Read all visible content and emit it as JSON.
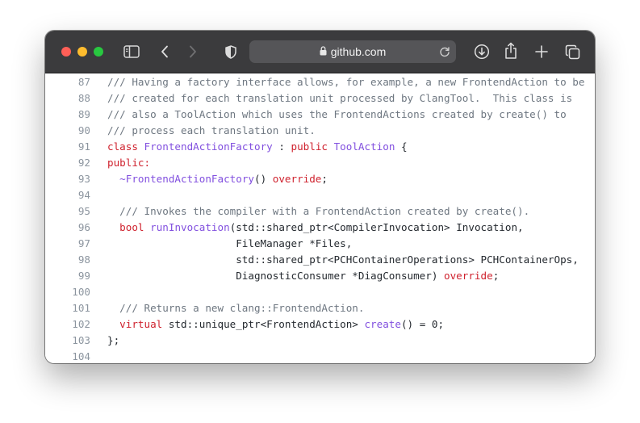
{
  "browser": {
    "url": "github.com",
    "colors": {
      "toolbar": "#3b3b3d",
      "urlbar": "#555558",
      "close": "#ff5f57",
      "minimize": "#febc2e",
      "zoom": "#28c840"
    },
    "icons": [
      "sidebar-icon",
      "back-icon",
      "forward-icon",
      "privacy-shield-icon",
      "lock-icon",
      "reload-icon",
      "download-icon",
      "share-icon",
      "new-tab-icon",
      "tabs-overview-icon"
    ]
  },
  "code": {
    "colors": {
      "comment": "#6e7781",
      "keyword": "#cf222e",
      "entity": "#8250df",
      "plain": "#24292f",
      "line_number": "#8c959f"
    },
    "lines": [
      {
        "num": "87",
        "tokens": [
          {
            "t": "/// Having a factory interface allows, for example, a new FrontendAction to be",
            "c": "comment"
          }
        ]
      },
      {
        "num": "88",
        "tokens": [
          {
            "t": "/// created for each translation unit processed by ClangTool.  This class is",
            "c": "comment"
          }
        ]
      },
      {
        "num": "89",
        "tokens": [
          {
            "t": "/// also a ToolAction which uses the FrontendActions created by create() to",
            "c": "comment"
          }
        ]
      },
      {
        "num": "90",
        "tokens": [
          {
            "t": "/// process each translation unit.",
            "c": "comment"
          }
        ]
      },
      {
        "num": "91",
        "tokens": [
          {
            "t": "class",
            "c": "keyword"
          },
          {
            "t": " ",
            "c": "plain"
          },
          {
            "t": "FrontendActionFactory",
            "c": "entity"
          },
          {
            "t": " : ",
            "c": "plain"
          },
          {
            "t": "public",
            "c": "keyword"
          },
          {
            "t": " ",
            "c": "plain"
          },
          {
            "t": "ToolAction",
            "c": "entity"
          },
          {
            "t": " {",
            "c": "plain"
          }
        ]
      },
      {
        "num": "92",
        "tokens": [
          {
            "t": "public:",
            "c": "keyword"
          }
        ]
      },
      {
        "num": "93",
        "tokens": [
          {
            "t": "  ",
            "c": "plain"
          },
          {
            "t": "~FrontendActionFactory",
            "c": "entity"
          },
          {
            "t": "() ",
            "c": "plain"
          },
          {
            "t": "override",
            "c": "keyword"
          },
          {
            "t": ";",
            "c": "plain"
          }
        ]
      },
      {
        "num": "94",
        "tokens": []
      },
      {
        "num": "95",
        "tokens": [
          {
            "t": "  /// Invokes the compiler with a FrontendAction created by create().",
            "c": "comment"
          }
        ]
      },
      {
        "num": "96",
        "tokens": [
          {
            "t": "  ",
            "c": "plain"
          },
          {
            "t": "bool",
            "c": "keyword"
          },
          {
            "t": " ",
            "c": "plain"
          },
          {
            "t": "runInvocation",
            "c": "entity"
          },
          {
            "t": "(std::shared_ptr<CompilerInvocation> Invocation,",
            "c": "plain"
          }
        ]
      },
      {
        "num": "97",
        "tokens": [
          {
            "t": "                     FileManager *Files,",
            "c": "plain"
          }
        ]
      },
      {
        "num": "98",
        "tokens": [
          {
            "t": "                     std::shared_ptr<PCHContainerOperations> PCHContainerOps,",
            "c": "plain"
          }
        ]
      },
      {
        "num": "99",
        "tokens": [
          {
            "t": "                     DiagnosticConsumer *DiagConsumer) ",
            "c": "plain"
          },
          {
            "t": "override",
            "c": "keyword"
          },
          {
            "t": ";",
            "c": "plain"
          }
        ]
      },
      {
        "num": "100",
        "tokens": []
      },
      {
        "num": "101",
        "tokens": [
          {
            "t": "  /// Returns a new clang::FrontendAction.",
            "c": "comment"
          }
        ]
      },
      {
        "num": "102",
        "tokens": [
          {
            "t": "  ",
            "c": "plain"
          },
          {
            "t": "virtual",
            "c": "keyword"
          },
          {
            "t": " std::unique_ptr<FrontendAction> ",
            "c": "plain"
          },
          {
            "t": "create",
            "c": "entity"
          },
          {
            "t": "() = 0;",
            "c": "plain"
          }
        ]
      },
      {
        "num": "103",
        "tokens": [
          {
            "t": "};",
            "c": "plain"
          }
        ]
      },
      {
        "num": "104",
        "tokens": []
      }
    ]
  }
}
